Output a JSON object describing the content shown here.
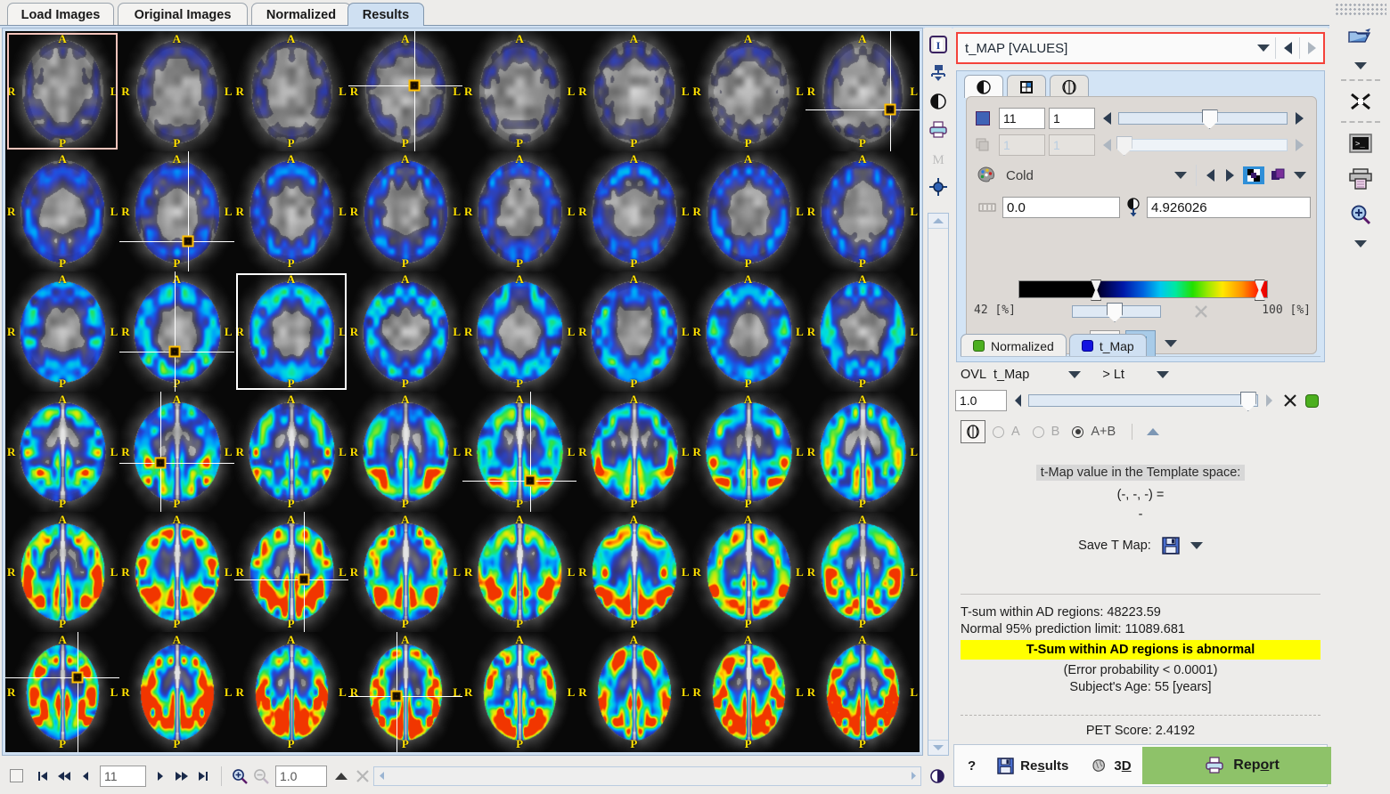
{
  "tabs": [
    {
      "label": "Load Images",
      "selected": false
    },
    {
      "label": "Original Images",
      "selected": false
    },
    {
      "label": "Normalized",
      "selected": false
    },
    {
      "label": "Results",
      "selected": true
    }
  ],
  "viewer": {
    "rows": 6,
    "cols": 8,
    "orientation_labels": {
      "anterior": "A",
      "posterior": "P",
      "right": "R",
      "left": "L"
    },
    "selected_slice_index": 18,
    "crosshair_slices": [
      3,
      7,
      9,
      17,
      25,
      28,
      34,
      43,
      40
    ],
    "bottom_toolbar": {
      "slice_number": "11",
      "zoom_factor": "1.0",
      "icons": [
        "checkbox-icon",
        "first-frame-icon",
        "fast-rewind-icon",
        "step-back-icon",
        "step-forward-icon",
        "fast-forward-icon",
        "last-frame-icon",
        "zoom-in-icon",
        "zoom-out-icon",
        "zoom-up-icon",
        "close-icon"
      ]
    }
  },
  "vstrip": {
    "icons": [
      "info-icon",
      "layout-tree-icon",
      "contrast-icon",
      "printer-icon",
      "m-marker-icon",
      "crosshair-icon"
    ]
  },
  "right_panel": {
    "map_select": {
      "value": "t_MAP [VALUES]",
      "dropdown_icon": "chevron-down-icon",
      "prev_icon": "step-back-icon",
      "next_icon": "step-forward-icon",
      "highlight_color": "#f4423a"
    },
    "inner_tabs": [
      {
        "icon": "contrast-icon",
        "selected": true
      },
      {
        "icon": "grid-layout-icon",
        "selected": false
      },
      {
        "icon": "brain-icon",
        "selected": false
      }
    ],
    "frame_controls": {
      "row1": {
        "enabled": true,
        "color_swatch": "#3f63b6",
        "value_a": "11",
        "value_b": "1",
        "slider_pct": 54
      },
      "row2": {
        "enabled": false,
        "value_a": "1",
        "value_b": "1",
        "slider_pct": 3
      }
    },
    "colortable": {
      "icon": "palette-icon",
      "name": "Cold",
      "dropdown_icon": "chevron-down-icon",
      "prev_icon": "step-back-icon",
      "next_icon": "step-forward-icon",
      "invert_icon": "invert-colors-icon",
      "copy_icon": "copy-colors-icon",
      "more_icon": "chevron-down-icon"
    },
    "range": {
      "min_icon": "range-icon",
      "min_value": "0.0",
      "max_icon": "threshold-icon",
      "max_value": "4.926026",
      "lower_pct_label": "42",
      "lower_pct_unit": "[%]",
      "upper_pct_label": "100",
      "upper_pct_unit": "[%]",
      "opacity_slider_pct": 48,
      "reset_icon": "close-icon",
      "colorbar_low_handle_pct": 31,
      "colorbar_high_handle_pct": 97
    },
    "bottom_buttons": [
      {
        "icon": "alpha-blend-icon",
        "selected": false
      },
      {
        "icon": "component-tree-icon",
        "selected": true
      },
      {
        "icon": "chevron-down-icon",
        "selected": false
      }
    ],
    "overlay_tabs": [
      {
        "label": "Normalized",
        "marker": "green",
        "selected": false
      },
      {
        "label": "t_Map",
        "marker": "blue",
        "selected": true
      }
    ],
    "overlay": {
      "ovl_label": "OVL",
      "ovl_value": "t_Map",
      "ovl_dropdown_icon": "chevron-down-icon",
      "comparator": "> Lt",
      "comparator_dropdown_icon": "chevron-down-icon",
      "threshold_value": "1.0",
      "threshold_slider_pct": 96,
      "clear_icon": "close-icon",
      "status_marker": "green",
      "blend_icon": "brain-icon",
      "radios": [
        {
          "label": "A",
          "selected": false,
          "enabled": false
        },
        {
          "label": "B",
          "selected": false,
          "enabled": false
        },
        {
          "label": "A+B",
          "selected": true,
          "enabled": true
        }
      ],
      "expand_icon": "chevron-up-icon"
    },
    "tmap_value": {
      "heading": "t-Map value in the Template space:",
      "coords": "(-, -, -) =",
      "value": "-"
    },
    "save_tmap": {
      "label": "Save T Map:",
      "save_icon": "floppy-disk-icon",
      "dropdown_icon": "chevron-down-icon"
    },
    "statistics": {
      "tsum": "T-sum within AD regions: 48223.59",
      "prediction_limit": "Normal 95% prediction limit: 11089.681",
      "verdict": "T-Sum within AD regions is abnormal",
      "verdict_bg": "#ffff00",
      "error_probability": "(Error probability < 0.0001)",
      "subject_age": "Subject's Age: 55 [years]",
      "pet_score": "PET Score: 2.4192"
    },
    "actions": {
      "help_label": "?",
      "results_label": "Results",
      "results_icon": "floppy-disk-icon",
      "threeD_label": "3D",
      "threeD_icon": "brain-3d-icon",
      "report_label": "Report",
      "report_icon": "printer-icon",
      "report_bg": "#8ec269"
    }
  },
  "right_toolbar": {
    "items": [
      {
        "icon": "open-file-icon"
      },
      {
        "icon": "chevron-down-icon"
      },
      {
        "icon": "separator"
      },
      {
        "icon": "shuffle-icon"
      },
      {
        "icon": "separator"
      },
      {
        "icon": "terminal-icon"
      },
      {
        "icon": "printer-icon"
      },
      {
        "icon": "zoom-in-icon"
      },
      {
        "icon": "chevron-down-icon"
      }
    ]
  }
}
